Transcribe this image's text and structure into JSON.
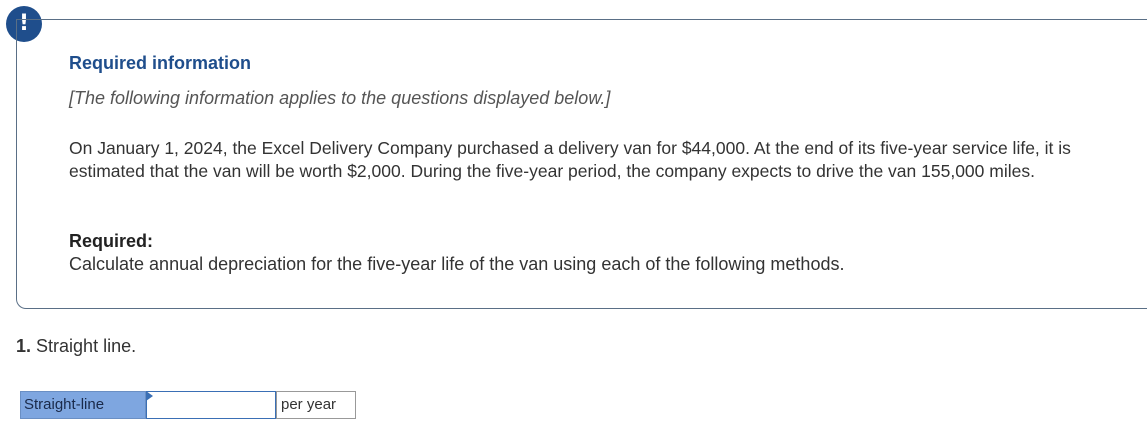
{
  "alert": {
    "icon": "exclamation-icon",
    "glyph": "!",
    "color": "#1f4e8c"
  },
  "info": {
    "title": "Required information",
    "note": "[The following information applies to the questions displayed below.]",
    "problem": "On January 1, 2024, the Excel Delivery Company purchased a delivery van for $44,000. At the end of its five-year service life, it is estimated that the van will be worth $2,000. During the five-year period, the company expects to drive the van 155,000 miles.",
    "required_label": "Required:",
    "required_text": "Calculate annual depreciation for the five-year life of the van using each of the following methods."
  },
  "question": {
    "number": "1.",
    "text": "Straight line."
  },
  "answer": {
    "method_label": "Straight-line",
    "input_value": "",
    "unit": "per year"
  }
}
